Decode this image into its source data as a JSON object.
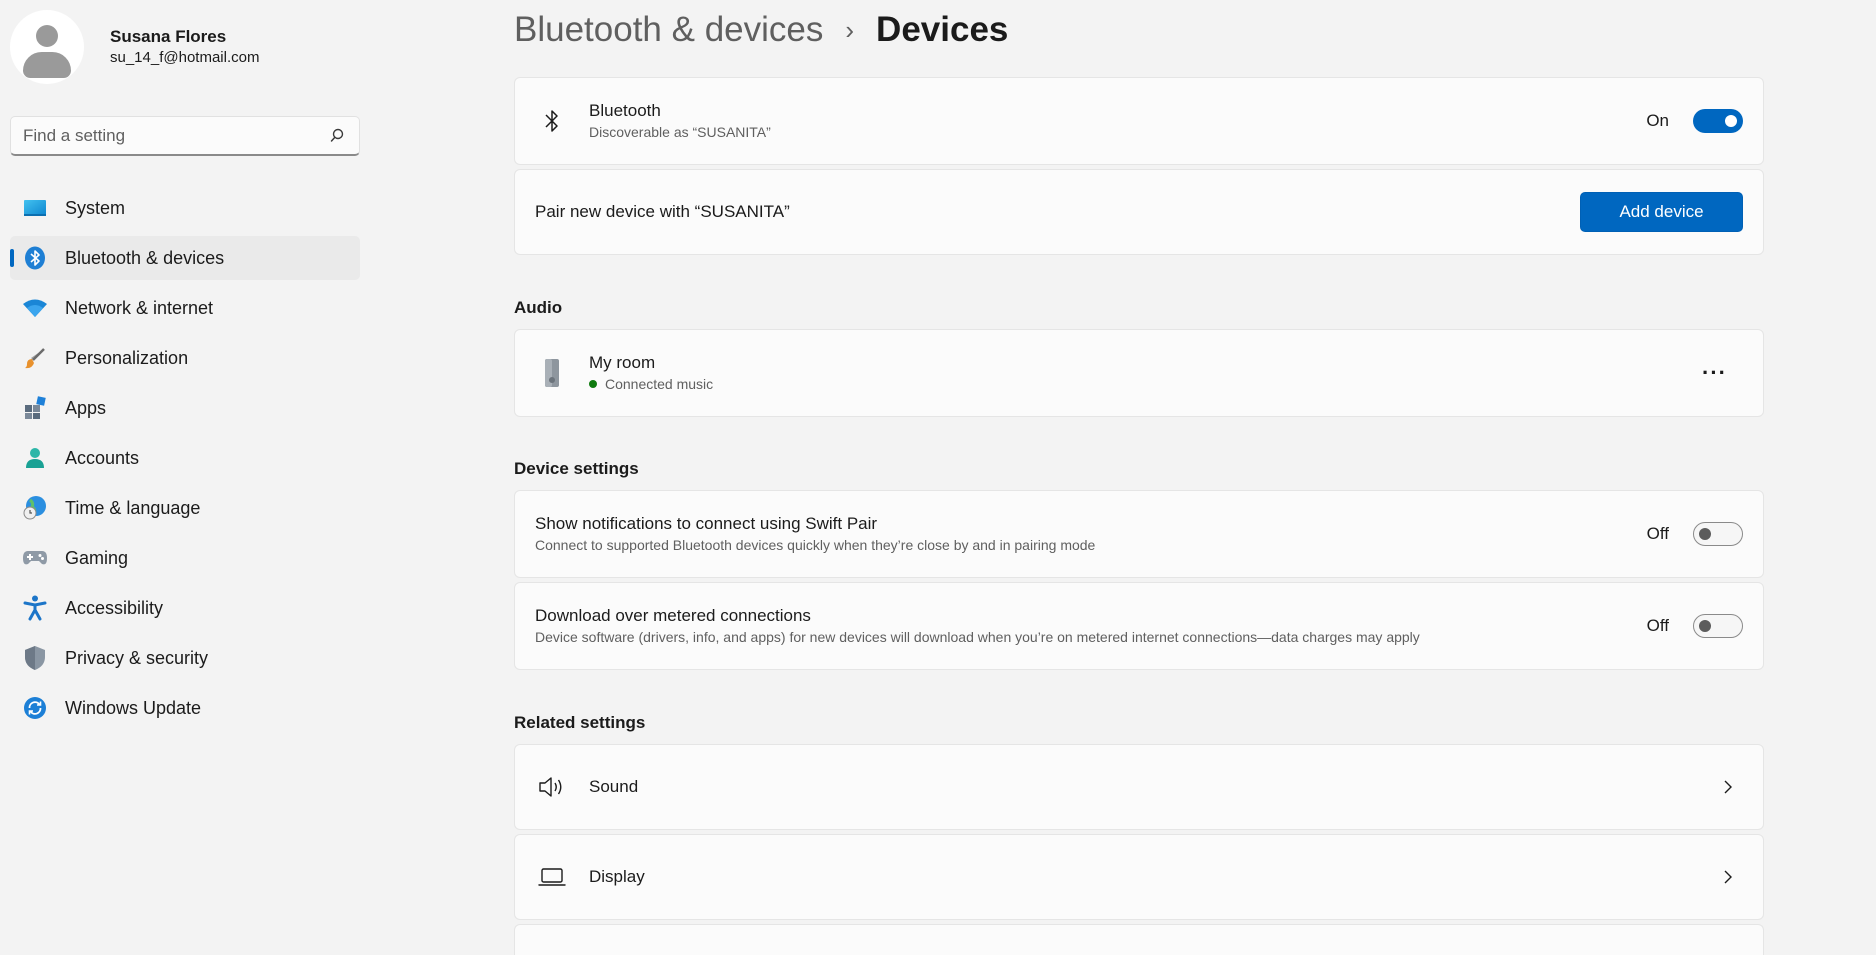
{
  "profile": {
    "name": "Susana Flores",
    "email": "su_14_f@hotmail.com"
  },
  "search": {
    "placeholder": "Find a setting",
    "value": ""
  },
  "sidebar": {
    "items": [
      {
        "label": "System",
        "icon": "monitor-icon"
      },
      {
        "label": "Bluetooth & devices",
        "icon": "bluetooth-icon",
        "active": true
      },
      {
        "label": "Network & internet",
        "icon": "wifi-icon"
      },
      {
        "label": "Personalization",
        "icon": "brush-icon"
      },
      {
        "label": "Apps",
        "icon": "apps-icon"
      },
      {
        "label": "Accounts",
        "icon": "person-icon"
      },
      {
        "label": "Time & language",
        "icon": "globe-clock-icon"
      },
      {
        "label": "Gaming",
        "icon": "gamepad-icon"
      },
      {
        "label": "Accessibility",
        "icon": "accessibility-icon"
      },
      {
        "label": "Privacy & security",
        "icon": "shield-icon"
      },
      {
        "label": "Windows Update",
        "icon": "sync-icon"
      }
    ]
  },
  "breadcrumb": {
    "parent": "Bluetooth & devices",
    "separator": "›",
    "current": "Devices"
  },
  "bluetooth": {
    "title": "Bluetooth",
    "subtitle": "Discoverable as “SUSANITA”",
    "state": "On"
  },
  "pair": {
    "label": "Pair new device with “SUSANITA”",
    "button": "Add device"
  },
  "audio": {
    "heading": "Audio",
    "device": {
      "name": "My room",
      "status": "Connected music",
      "more": "···"
    }
  },
  "device_settings": {
    "heading": "Device settings",
    "swift_pair": {
      "title": "Show notifications to connect using Swift Pair",
      "subtitle": "Connect to supported Bluetooth devices quickly when they’re close by and in pairing mode",
      "state": "Off"
    },
    "metered": {
      "title": "Download over metered connections",
      "subtitle": "Device software (drivers, info, and apps) for new devices will download when you’re on metered internet connections—data charges may apply",
      "state": "Off"
    }
  },
  "related": {
    "heading": "Related settings",
    "items": [
      {
        "label": "Sound",
        "icon": "speaker-icon"
      },
      {
        "label": "Display",
        "icon": "laptop-icon"
      }
    ]
  },
  "colors": {
    "accent": "#0067c0",
    "background": "#f3f3f3",
    "card": "#fbfbfb",
    "connected": "#0f7b0f"
  }
}
